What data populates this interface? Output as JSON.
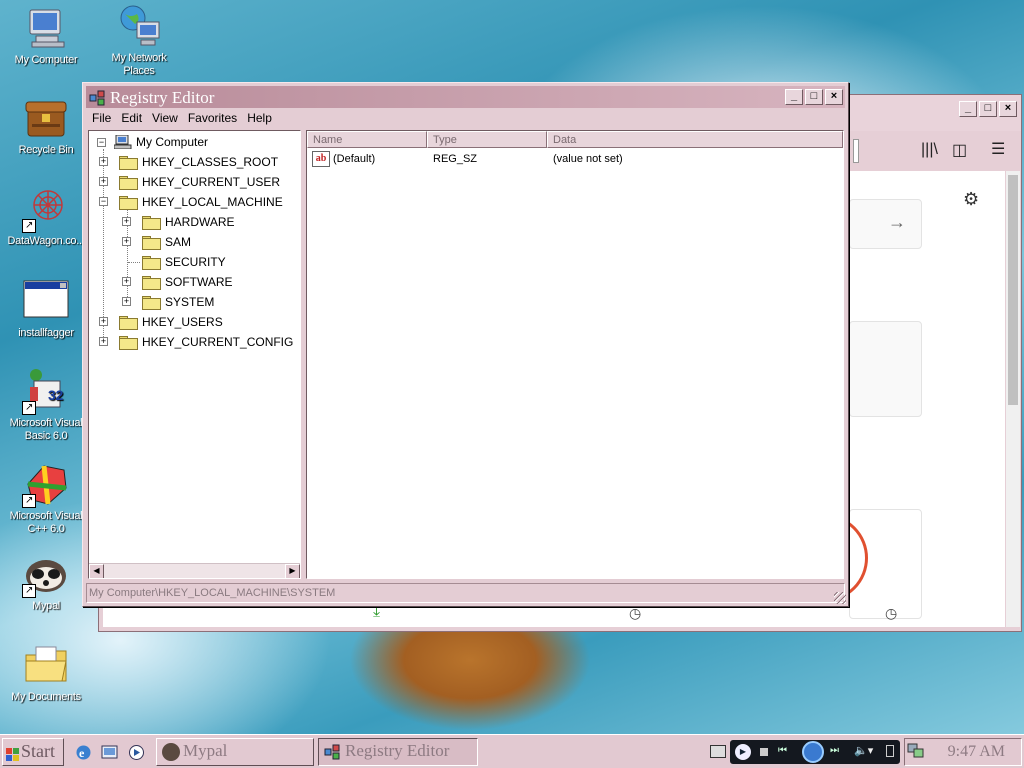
{
  "desktop": {
    "icons": [
      {
        "label": "My Computer",
        "icon": "computer-icon"
      },
      {
        "label": "My Network Places",
        "icon": "network-icon"
      },
      {
        "label": "Recycle Bin",
        "icon": "recycle-bin-icon"
      },
      {
        "label": "DataWagon.co...",
        "icon": "web-shortcut-icon"
      },
      {
        "label": "installfagger",
        "icon": "program-window-icon"
      },
      {
        "label": "Microsoft Visual Basic 6.0",
        "icon": "visual-basic-icon"
      },
      {
        "label": "Microsoft Visual C++ 6.0",
        "icon": "visual-cpp-icon"
      },
      {
        "label": "Mypal",
        "icon": "mypal-browser-icon"
      },
      {
        "label": "My Documents",
        "icon": "my-documents-icon"
      }
    ]
  },
  "regedit": {
    "title": "Registry Editor",
    "menu": [
      "File",
      "Edit",
      "View",
      "Favorites",
      "Help"
    ],
    "tree": {
      "root": "My Computer",
      "hives": [
        "HKEY_CLASSES_ROOT",
        "HKEY_CURRENT_USER",
        "HKEY_LOCAL_MACHINE",
        "HKEY_USERS",
        "HKEY_CURRENT_CONFIG"
      ],
      "hklm_children": [
        "HARDWARE",
        "SAM",
        "SECURITY",
        "SOFTWARE",
        "SYSTEM"
      ]
    },
    "columns": [
      "Name",
      "Type",
      "Data"
    ],
    "values": [
      {
        "name": "(Default)",
        "type": "REG_SZ",
        "data": "(value not set)"
      }
    ],
    "status": "My Computer\\HKEY_LOCAL_MACHINE\\SYSTEM"
  },
  "taskbar": {
    "start": "Start",
    "tasks": [
      "Mypal",
      "Registry Editor"
    ],
    "active_task": "Registry Editor",
    "clock": "9:47 AM"
  },
  "colors": {
    "theme": "#e2c9d1",
    "title_gradient": "#b88b99"
  }
}
